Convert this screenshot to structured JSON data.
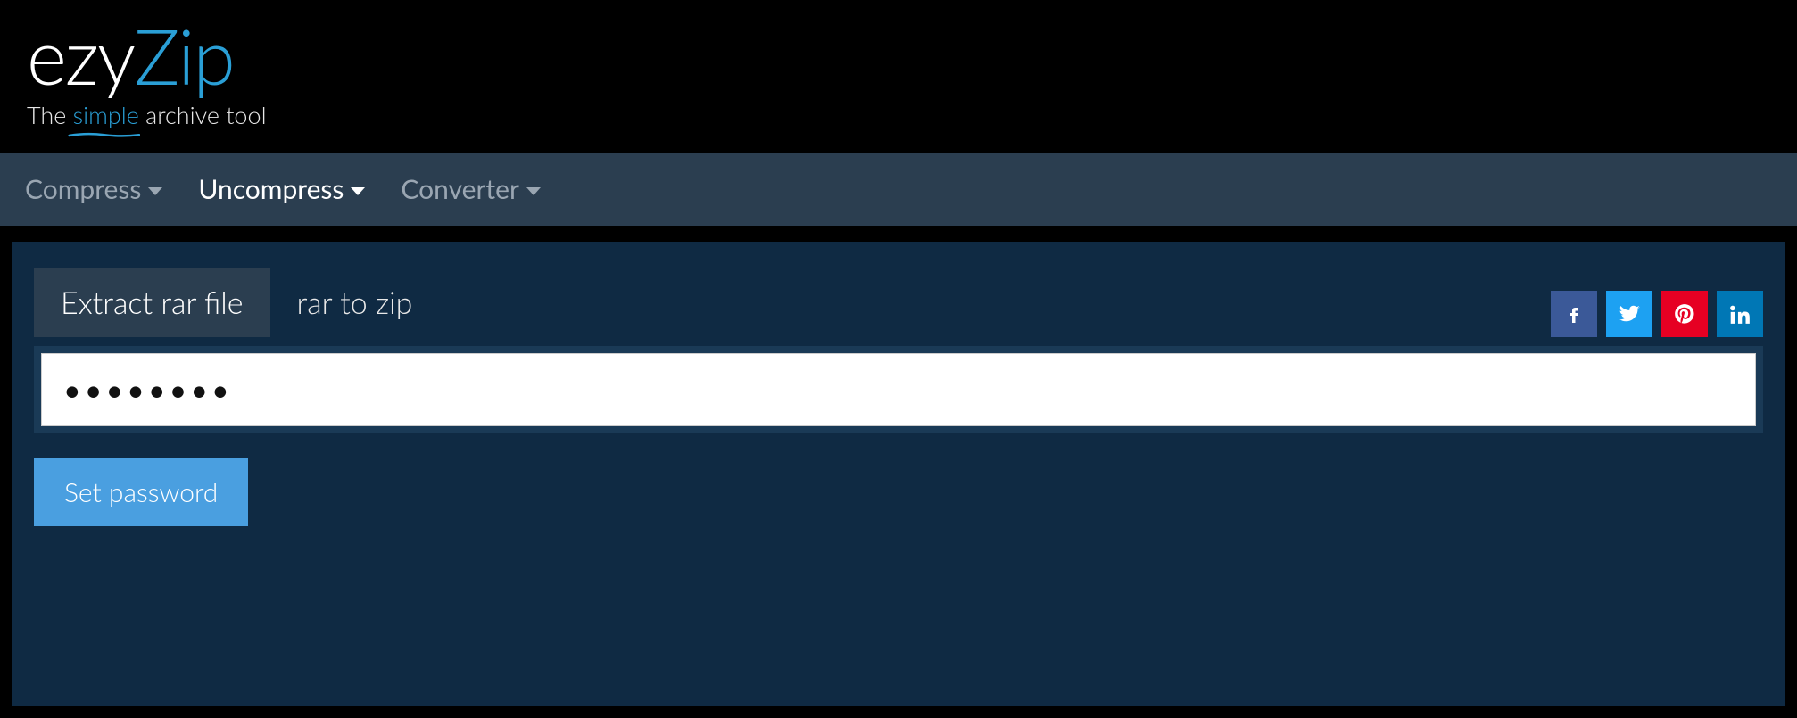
{
  "logo": {
    "part1": "ezy",
    "part2": "Zip",
    "tagline_pre": "The ",
    "tagline_simple": "simple",
    "tagline_post": " archive tool"
  },
  "nav": {
    "items": [
      {
        "label": "Compress",
        "active": false
      },
      {
        "label": "Uncompress",
        "active": true
      },
      {
        "label": "Converter",
        "active": false
      }
    ]
  },
  "tabs": [
    {
      "label": "Extract rar file",
      "active": true
    },
    {
      "label": "rar to zip",
      "active": false
    }
  ],
  "social": {
    "facebook": "facebook",
    "twitter": "twitter",
    "pinterest": "pinterest",
    "linkedin": "linkedin"
  },
  "password": {
    "value": "password",
    "placeholder": ""
  },
  "buttons": {
    "set_password": "Set password"
  }
}
